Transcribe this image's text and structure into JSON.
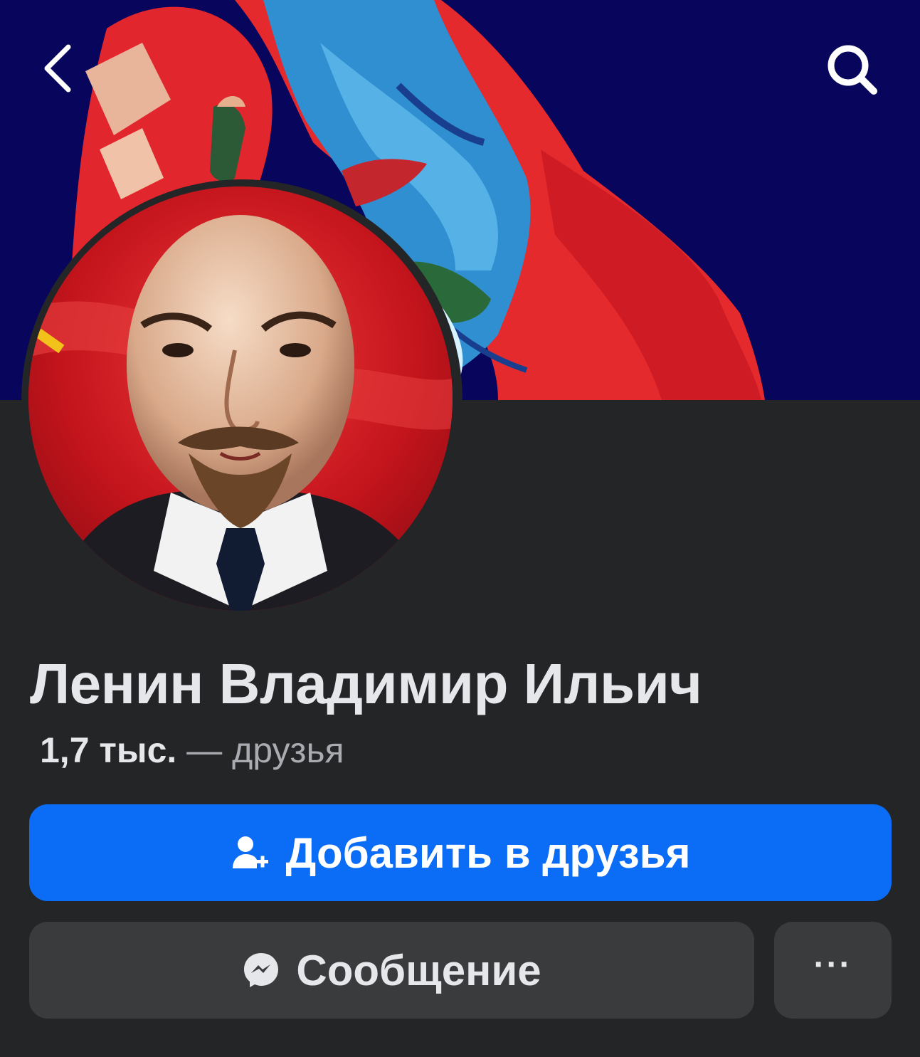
{
  "profile": {
    "name": "Ленин Владимир Ильич",
    "friends_count": "1,7 тыс.",
    "friends_label": "— друзья"
  },
  "actions": {
    "add_friend_label": "Добавить в друзья",
    "message_label": "Сообщение",
    "more_label": "···"
  },
  "colors": {
    "background": "#242527",
    "primary_button": "#0b6cf6",
    "secondary_button": "#3a3b3d",
    "text_primary": "#e6e7ea",
    "text_secondary": "#a9abb0"
  },
  "icons": {
    "back": "chevron-left-icon",
    "search": "search-icon",
    "add_friend": "add-friend-icon",
    "messenger": "messenger-icon"
  }
}
